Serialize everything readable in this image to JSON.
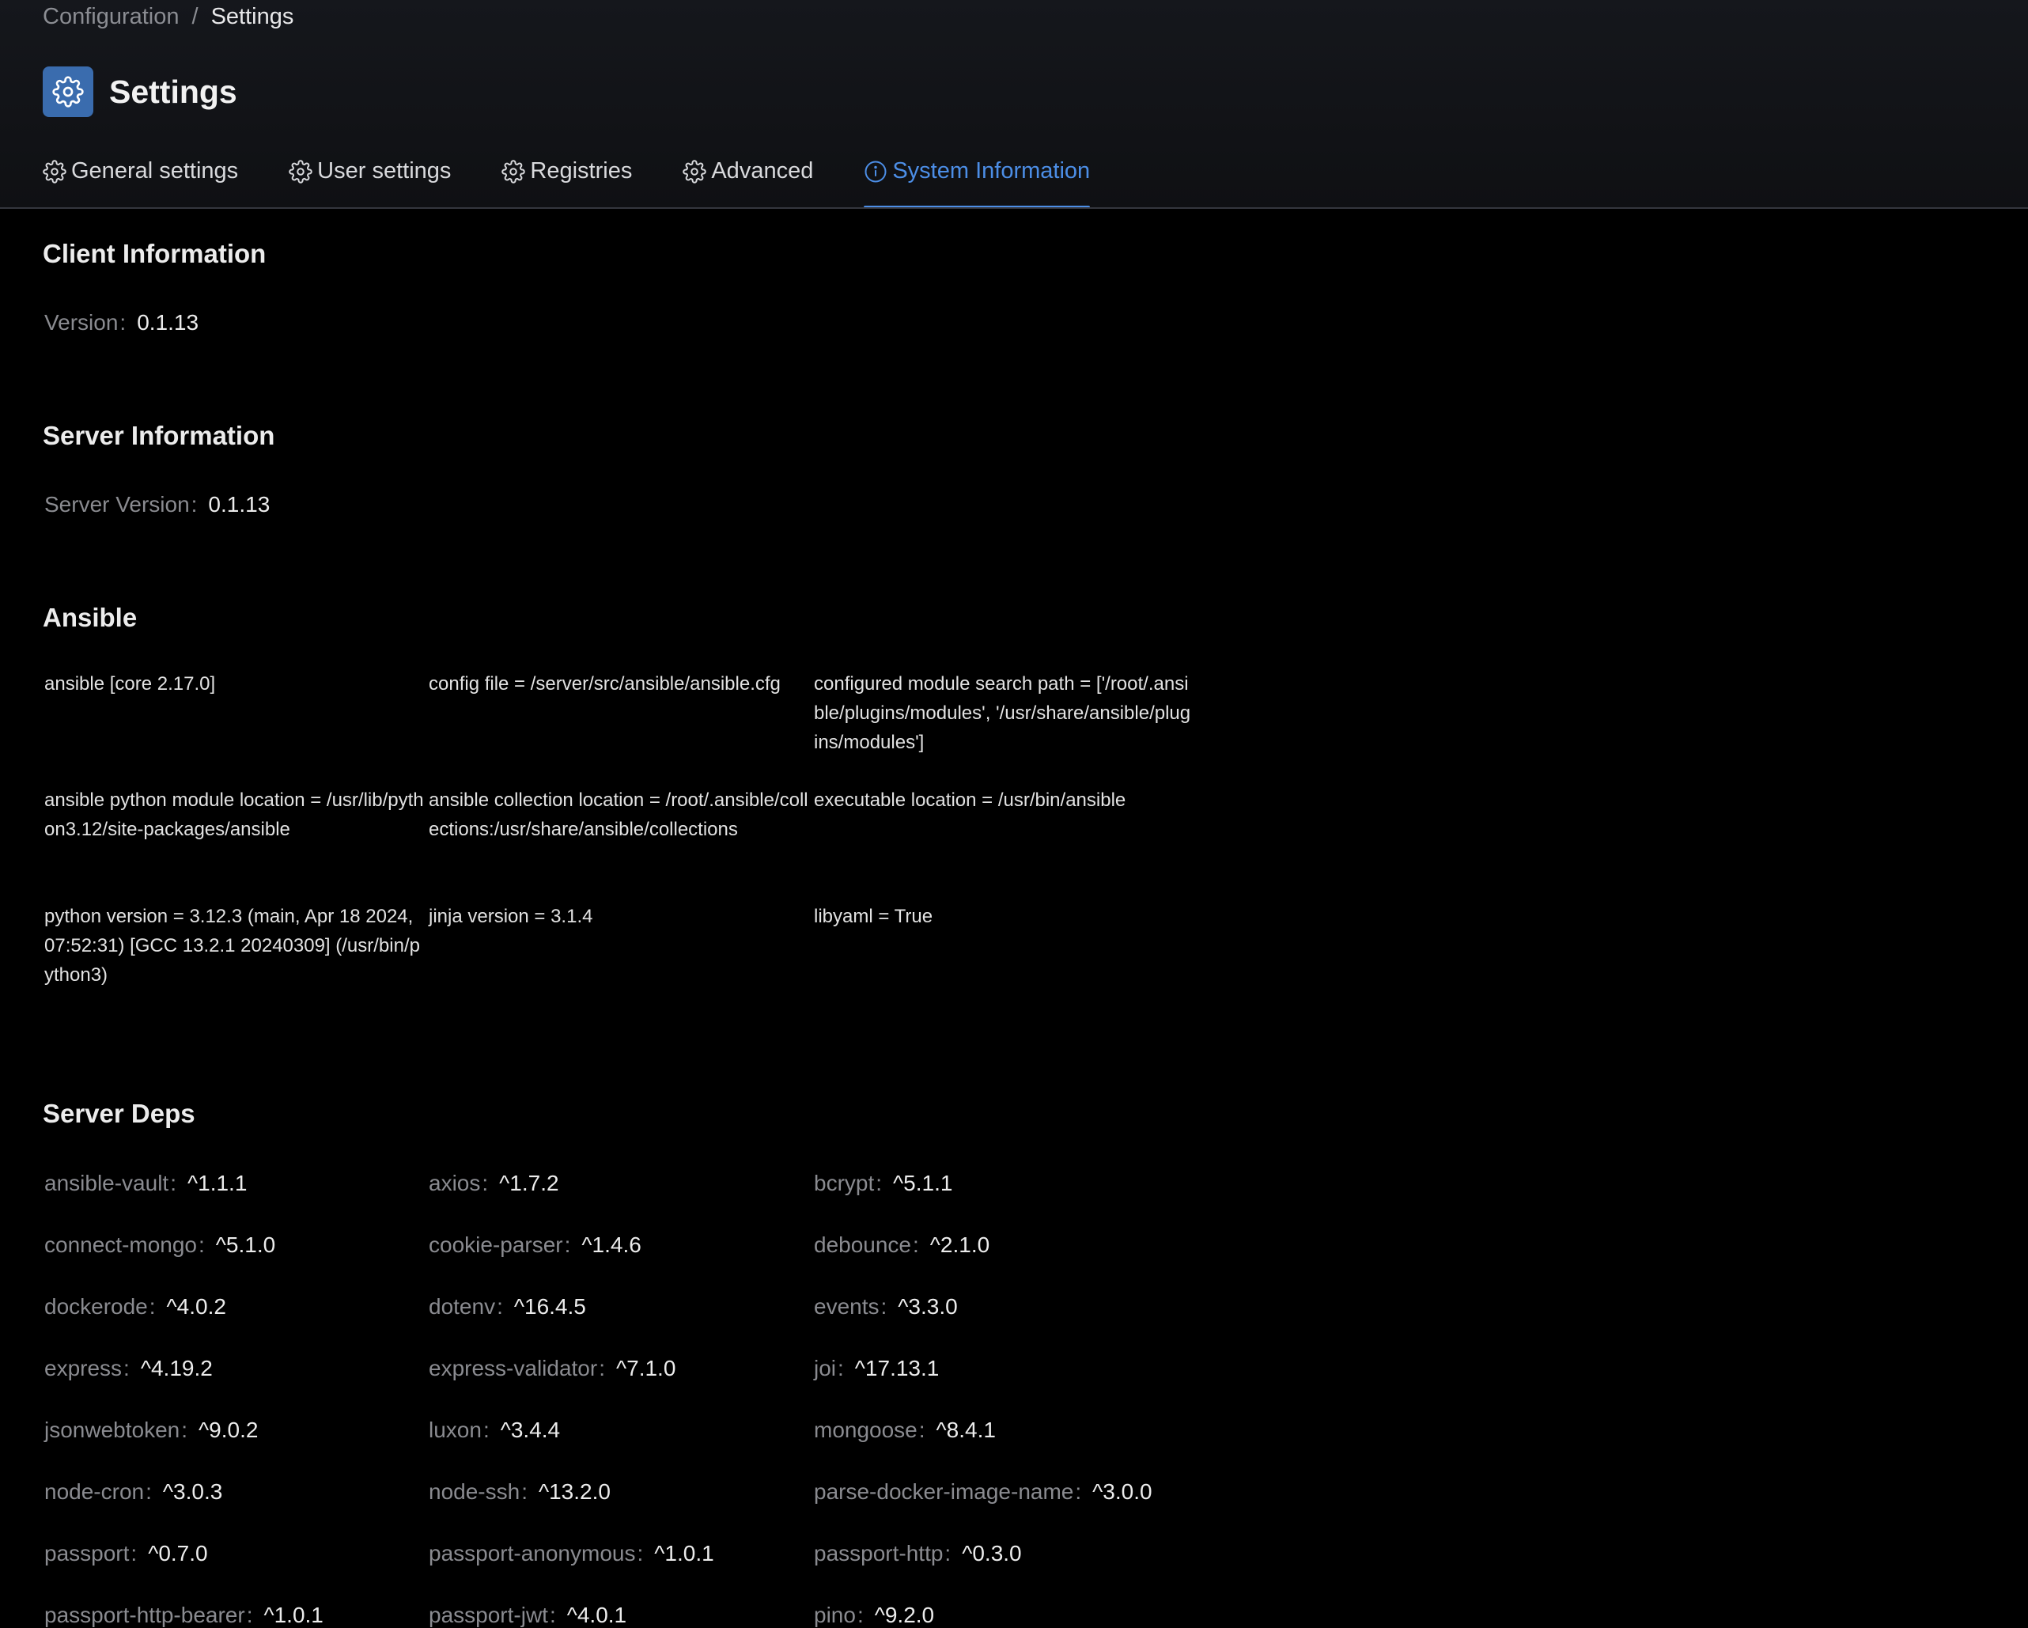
{
  "breadcrumb": {
    "parent": "Configuration",
    "separator": "/",
    "current": "Settings"
  },
  "page": {
    "title": "Settings",
    "icon": "gear-icon",
    "icon_bg": "#3a6cae"
  },
  "tabs": [
    {
      "label": "General settings",
      "icon": "gear-icon"
    },
    {
      "label": "User settings",
      "icon": "gear-icon"
    },
    {
      "label": "Registries",
      "icon": "gear-icon"
    },
    {
      "label": "Advanced",
      "icon": "gear-icon"
    },
    {
      "label": "System Information",
      "icon": "info-icon",
      "active": true
    }
  ],
  "accent_color": "#4c8ee6",
  "client": {
    "title": "Client Information",
    "version_label": "Version",
    "version_value": "0.1.13"
  },
  "server": {
    "title": "Server Information",
    "version_label": "Server Version",
    "version_value": "0.1.13"
  },
  "ansible": {
    "title": "Ansible",
    "items": [
      "ansible [core 2.17.0]",
      "config file = /server/src/ansible/ansible.cfg",
      "configured module search path = ['/root/.ansible/plugins/modules', '/usr/share/ansible/plugins/modules']",
      "ansible python module location = /usr/lib/python3.12/site-packages/ansible",
      "ansible collection location = /root/.ansible/collections:/usr/share/ansible/collections",
      "executable location = /usr/bin/ansible",
      "python version = 3.12.3 (main, Apr 18 2024, 07:52:31) [GCC 13.2.1 20240309] (/usr/bin/python3)",
      "jinja version = 3.1.4",
      "libyaml = True"
    ]
  },
  "deps": {
    "title": "Server Deps",
    "items": [
      {
        "name": "ansible-vault",
        "version": "^1.1.1"
      },
      {
        "name": "axios",
        "version": "^1.7.2"
      },
      {
        "name": "bcrypt",
        "version": "^5.1.1"
      },
      {
        "name": "connect-mongo",
        "version": "^5.1.0"
      },
      {
        "name": "cookie-parser",
        "version": "^1.4.6"
      },
      {
        "name": "debounce",
        "version": "^2.1.0"
      },
      {
        "name": "dockerode",
        "version": "^4.0.2"
      },
      {
        "name": "dotenv",
        "version": "^16.4.5"
      },
      {
        "name": "events",
        "version": "^3.3.0"
      },
      {
        "name": "express",
        "version": "^4.19.2"
      },
      {
        "name": "express-validator",
        "version": "^7.1.0"
      },
      {
        "name": "joi",
        "version": "^17.13.1"
      },
      {
        "name": "jsonwebtoken",
        "version": "^9.0.2"
      },
      {
        "name": "luxon",
        "version": "^3.4.4"
      },
      {
        "name": "mongoose",
        "version": "^8.4.1"
      },
      {
        "name": "node-cron",
        "version": "^3.0.3"
      },
      {
        "name": "node-ssh",
        "version": "^13.2.0"
      },
      {
        "name": "parse-docker-image-name",
        "version": "^3.0.0"
      },
      {
        "name": "passport",
        "version": "^0.7.0"
      },
      {
        "name": "passport-anonymous",
        "version": "^1.0.1"
      },
      {
        "name": "passport-http",
        "version": "^0.3.0"
      },
      {
        "name": "passport-http-bearer",
        "version": "^1.0.1"
      },
      {
        "name": "passport-jwt",
        "version": "^4.0.1"
      },
      {
        "name": "pino",
        "version": "^9.2.0"
      }
    ]
  }
}
